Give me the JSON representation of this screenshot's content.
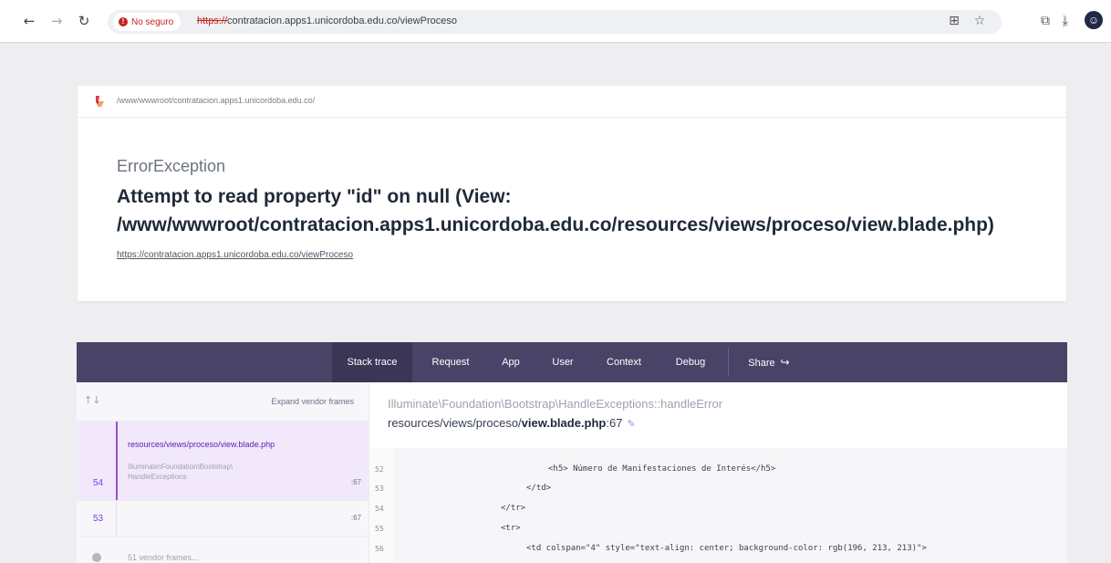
{
  "browser": {
    "insecure_label": "No seguro",
    "url_scheme": "https://",
    "url_rest": "contratacion.apps1.unicordoba.edu.co/viewProceso",
    "icons": [
      "back-icon",
      "forward-icon",
      "reload-icon",
      "translate-icon",
      "star-icon",
      "extensions-icon",
      "download-icon",
      "profile-icon"
    ]
  },
  "error": {
    "root_path": "/www/wwwroot/contratacion.apps1.unicordoba.edu.co/",
    "exception_class": "ErrorException",
    "message_line1": "Attempt to read property \"id\" on null (View:",
    "message_line2": "/www/wwwroot/contratacion.apps1.unicordoba.edu.co/resources/views/proceso/view.blade.php)",
    "url": "https://contratacion.apps1.unicordoba.edu.co/viewProceso"
  },
  "tabs": {
    "stack_trace": "Stack trace",
    "request": "Request",
    "app": "App",
    "user": "User",
    "context": "Context",
    "debug": "Debug",
    "share": "Share"
  },
  "frames": {
    "sort_icon": "↑↓",
    "expand_vendor": "Expand vendor frames",
    "items": [
      {
        "num": "54",
        "file": "resources/views/proceso/view.blade.php",
        "ns1": "Illuminate\\Foundation\\Bootstrap\\",
        "ns2": "HandleExceptions",
        "line": ":67"
      },
      {
        "num": "53",
        "line": ":67"
      }
    ],
    "vendor_label": "51 vendor frames..."
  },
  "code": {
    "frame_class": "Illuminate\\Foundation\\Bootstrap\\HandleExceptions::handleError",
    "frame_path_prefix": "resources/views/proceso/",
    "frame_path_file": "view.blade.php",
    "frame_path_line": ":67",
    "lines": [
      {
        "n": "52",
        "text": "<h5> Número de Manifestaciones de Interés</h5>"
      },
      {
        "n": "53",
        "text": "</td>"
      },
      {
        "n": "54",
        "text": "</tr>"
      },
      {
        "n": "55",
        "text": "<tr>"
      },
      {
        "n": "56",
        "text": "<td colspan=\"4\" style=\"text-align: center; background-color: rgb(196, 213, 213)\">"
      }
    ]
  },
  "colors": {
    "accent": "#9b4dca",
    "tabbar": "#4a4368",
    "insecure": "#c5221f"
  }
}
